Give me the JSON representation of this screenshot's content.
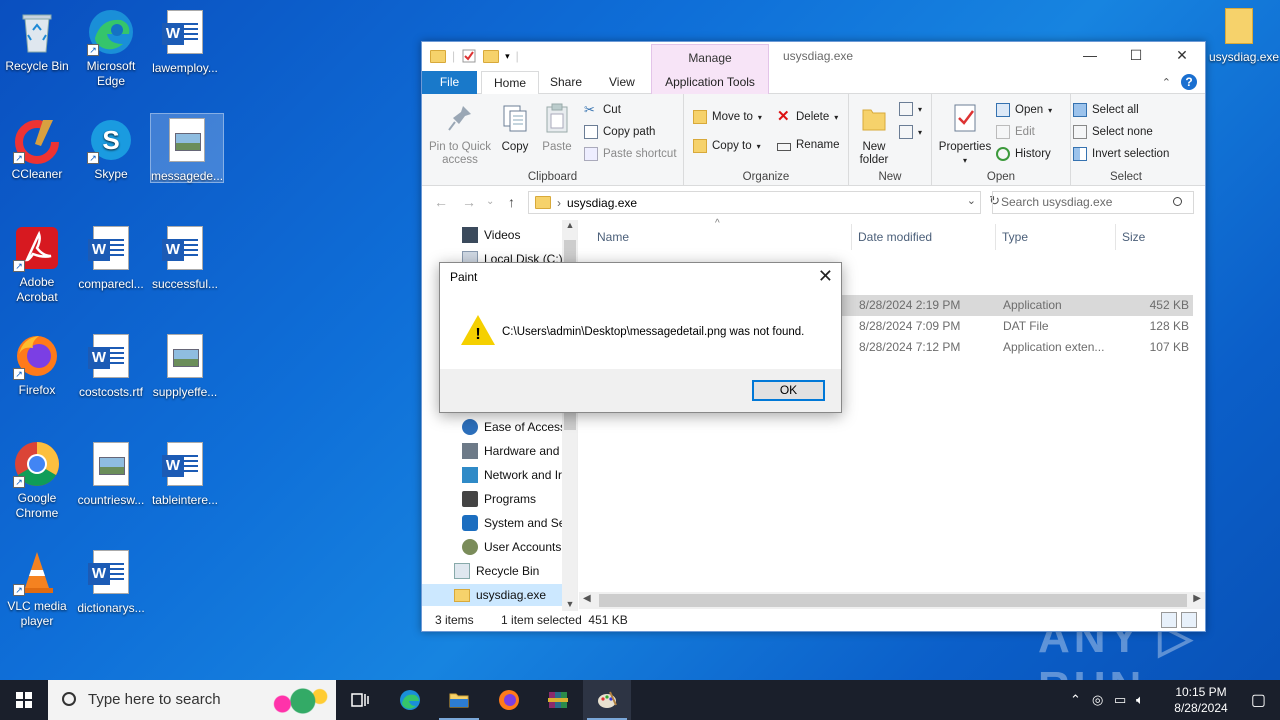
{
  "desktop": {
    "icons": [
      {
        "label": "Recycle Bin"
      },
      {
        "label": "Microsoft Edge"
      },
      {
        "label": "lawemploy..."
      },
      {
        "label": "CCleaner"
      },
      {
        "label": "Skype"
      },
      {
        "label": "messagede..."
      },
      {
        "label": "Adobe Acrobat"
      },
      {
        "label": "comparecl..."
      },
      {
        "label": "successful..."
      },
      {
        "label": "Firefox"
      },
      {
        "label": "costcosts.rtf"
      },
      {
        "label": "supplyeffe..."
      },
      {
        "label": "Google Chrome"
      },
      {
        "label": "countriesw..."
      },
      {
        "label": "tableintere..."
      },
      {
        "label": "VLC media player"
      },
      {
        "label": "dictionarys..."
      }
    ],
    "top_right_label": "usysdiag.exe",
    "watermark": "ANY ▷ RUN"
  },
  "explorer": {
    "title": "usysdiag.exe",
    "manage_tab": "Manage",
    "tabs": {
      "file": "File",
      "home": "Home",
      "share": "Share",
      "view": "View",
      "app_tools": "Application Tools"
    },
    "ribbon": {
      "pin": "Pin to Quick access",
      "copy": "Copy",
      "paste": "Paste",
      "cut": "Cut",
      "copy_path": "Copy path",
      "paste_shortcut": "Paste shortcut",
      "clipboard": "Clipboard",
      "move_to": "Move to",
      "copy_to": "Copy to",
      "delete": "Delete",
      "rename": "Rename",
      "organize": "Organize",
      "new_folder": "New folder",
      "new": "New",
      "properties": "Properties",
      "open": "Open",
      "edit": "Edit",
      "history": "History",
      "open_group": "Open",
      "select_all": "Select all",
      "select_none": "Select none",
      "invert_selection": "Invert selection",
      "select": "Select"
    },
    "address": "usysdiag.exe",
    "search_placeholder": "Search usysdiag.exe",
    "nav": {
      "videos": "Videos",
      "local_disk": "Local Disk (C:)",
      "ease": "Ease of Access",
      "hardware": "Hardware and",
      "network": "Network and Ir",
      "programs": "Programs",
      "system": "System and Sec",
      "user_accounts": "User Accounts",
      "recycle": "Recycle Bin",
      "usysdiag": "usysdiag.exe"
    },
    "columns": {
      "name": "Name",
      "date": "Date modified",
      "type": "Type",
      "size": "Size"
    },
    "files": [
      {
        "date": "8/28/2024 2:19 PM",
        "type": "Application",
        "size": "452 KB"
      },
      {
        "date": "8/28/2024 7:09 PM",
        "type": "DAT File",
        "size": "128 KB"
      },
      {
        "date": "8/28/2024 7:12 PM",
        "type": "Application exten...",
        "size": "107 KB"
      }
    ],
    "status": {
      "items": "3 items",
      "selected": "1 item selected  451 KB"
    }
  },
  "dialog": {
    "title": "Paint",
    "message": "C:\\Users\\admin\\Desktop\\messagedetail.png was not found.",
    "ok": "OK"
  },
  "taskbar": {
    "search_placeholder": "Type here to search",
    "time": "10:15 PM",
    "date": "8/28/2024"
  }
}
